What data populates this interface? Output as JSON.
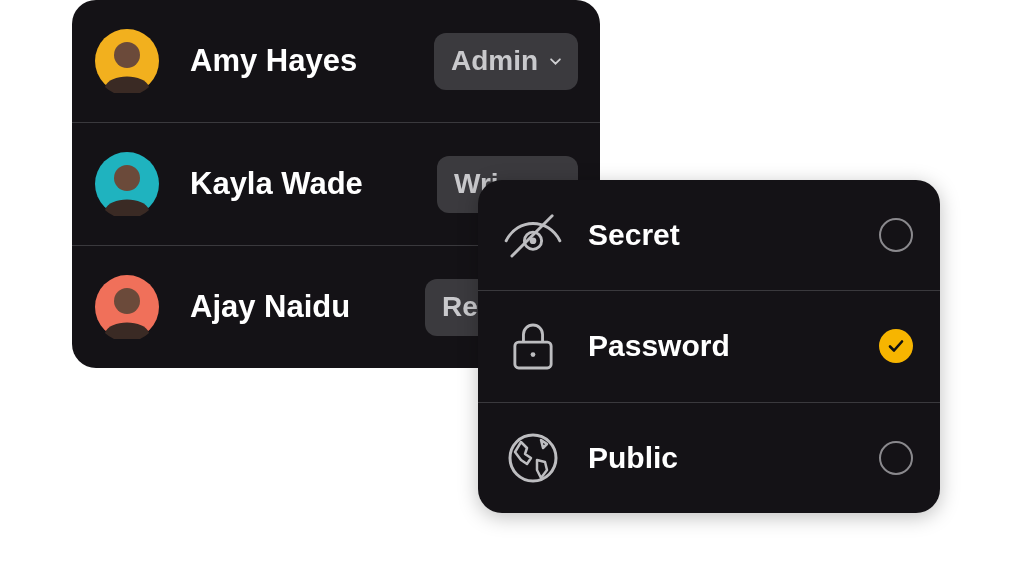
{
  "members": [
    {
      "name": "Amy Hayes",
      "role": "Admin",
      "caret": true,
      "color": "#f2b01e"
    },
    {
      "name": "Kayla Wade",
      "role": "Wri",
      "color": "#1fb3bf"
    },
    {
      "name": "Ajay Naidu",
      "role": "Re",
      "color": "#f0705a"
    }
  ],
  "visibility_options": [
    {
      "label": "Secret",
      "kind": "secret",
      "selected": false
    },
    {
      "label": "Password",
      "kind": "password",
      "selected": true
    },
    {
      "label": "Public",
      "kind": "public",
      "selected": false
    }
  ]
}
